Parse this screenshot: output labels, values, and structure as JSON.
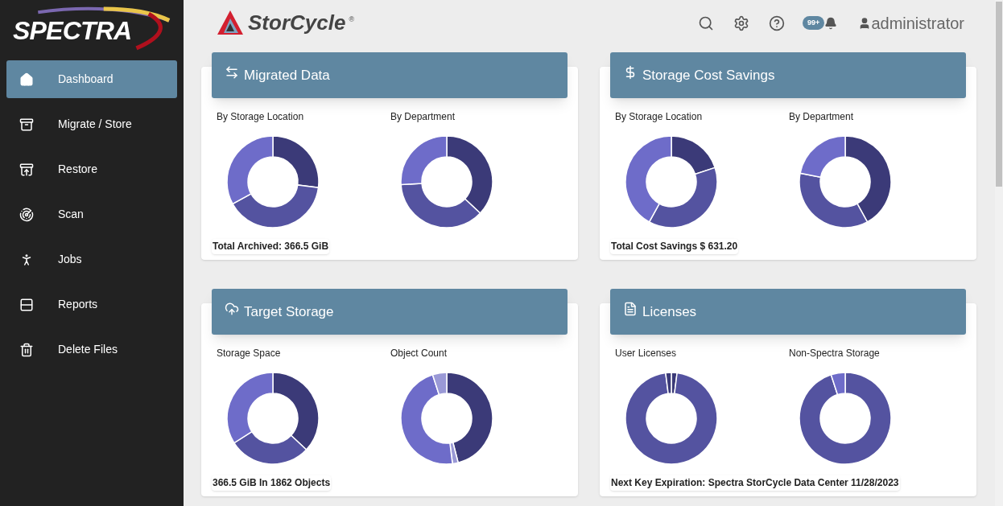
{
  "sidebar": {
    "logo": "SPECTRA",
    "items": [
      {
        "label": "Dashboard",
        "selected": true
      },
      {
        "label": "Migrate / Store",
        "selected": false
      },
      {
        "label": "Restore",
        "selected": false
      },
      {
        "label": "Scan",
        "selected": false
      },
      {
        "label": "Jobs",
        "selected": false
      },
      {
        "label": "Reports",
        "selected": false
      },
      {
        "label": "Delete Files",
        "selected": false
      }
    ]
  },
  "header": {
    "product": "StorCycle",
    "registered": "®",
    "notification_badge": "99+",
    "user": "administrator"
  },
  "cards": [
    {
      "title": "Migrated Data",
      "charts": [
        "By Storage Location",
        "By Department"
      ],
      "footer": "Total Archived: 366.5 GiB"
    },
    {
      "title": "Storage Cost Savings",
      "charts": [
        "By Storage Location",
        "By Department"
      ],
      "footer": "Total Cost Savings $ 631.20"
    },
    {
      "title": "Target Storage",
      "charts": [
        "Storage Space",
        "Object Count"
      ],
      "footer": "366.5 GiB In 1862 Objects"
    },
    {
      "title": "Licenses",
      "charts": [
        "User Licenses",
        "Non-Spectra Storage"
      ],
      "footer": "Next Key Expiration: Spectra StorCycle Data Center 11/28/2023"
    }
  ]
}
